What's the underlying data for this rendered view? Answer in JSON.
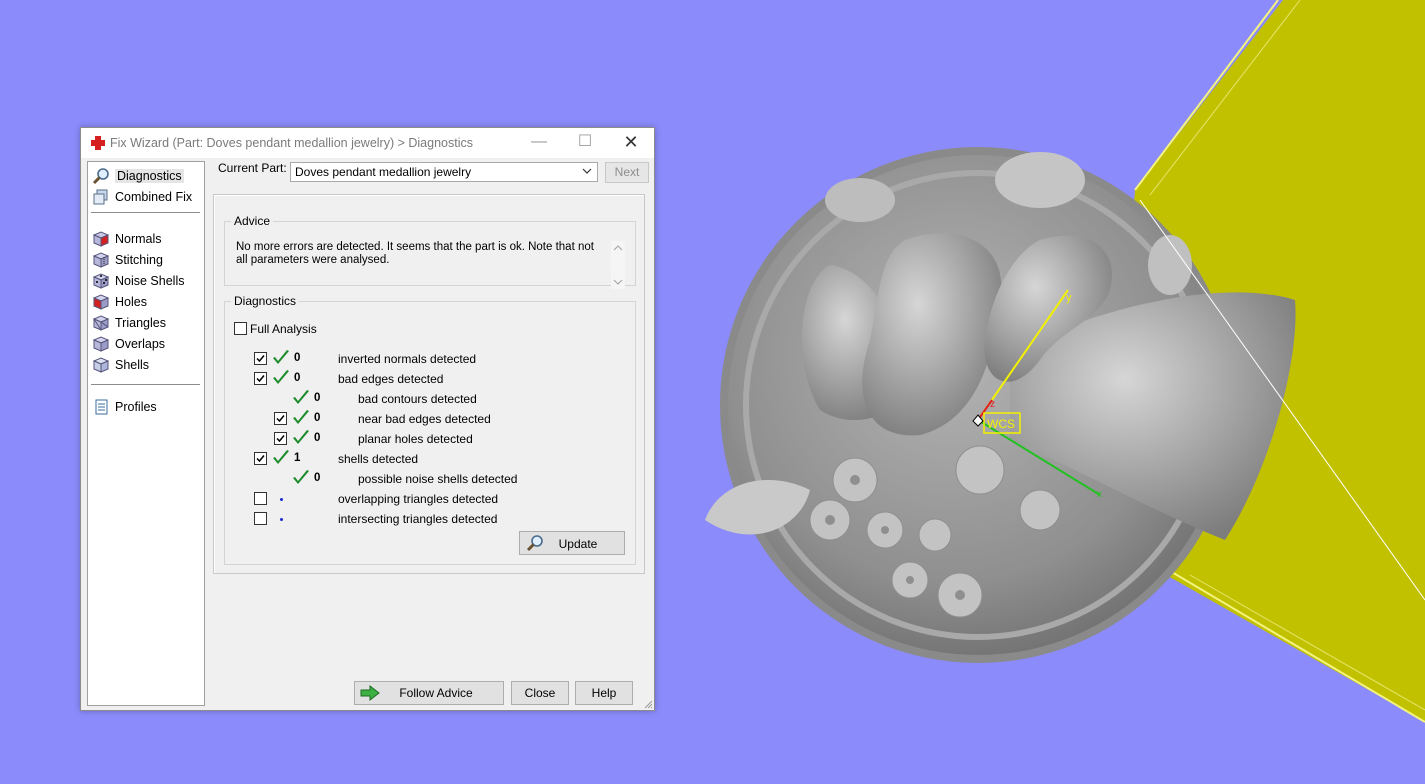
{
  "window": {
    "title": "Fix Wizard (Part: Doves pendant medallion jewelry) > Diagnostics",
    "minimize_glyph": "—",
    "maximize_glyph": "☐",
    "close_glyph": "✕"
  },
  "nav": {
    "items": [
      {
        "label": "Diagnostics",
        "icon": "magnifier-icon",
        "selected": true
      },
      {
        "label": "Combined Fix",
        "icon": "combined-fix-icon"
      },
      {
        "label": "Normals",
        "icon": "normals-cube-icon"
      },
      {
        "label": "Stitching",
        "icon": "stitching-cube-icon"
      },
      {
        "label": "Noise Shells",
        "icon": "noise-shells-icon"
      },
      {
        "label": "Holes",
        "icon": "holes-cube-icon"
      },
      {
        "label": "Triangles",
        "icon": "triangles-cube-icon"
      },
      {
        "label": "Overlaps",
        "icon": "overlaps-icon"
      },
      {
        "label": "Shells",
        "icon": "shells-icon"
      },
      {
        "label": "Profiles",
        "icon": "profiles-document-icon"
      }
    ]
  },
  "current_part": {
    "label": "Current Part:",
    "value": "Doves pendant medallion jewelry",
    "next_label": "Next"
  },
  "advice": {
    "legend": "Advice",
    "text": "No more errors are detected. It seems that the part is ok. Note that not all parameters were analysed."
  },
  "diagnostics": {
    "legend": "Diagnostics",
    "full_analysis_label": "Full Analysis",
    "full_analysis_checked": false,
    "rows": [
      {
        "checked": true,
        "status": "ok",
        "count": "0",
        "label": "inverted normals detected"
      },
      {
        "checked": true,
        "status": "ok",
        "count": "0",
        "label": "bad edges detected"
      },
      {
        "status": "ok",
        "count": "0",
        "label": "bad contours detected"
      },
      {
        "checked": true,
        "status": "ok",
        "count": "0",
        "label": "near bad edges detected"
      },
      {
        "checked": true,
        "status": "ok",
        "count": "0",
        "label": "planar holes detected"
      },
      {
        "checked": true,
        "status": "ok",
        "count": "1",
        "label": "shells detected"
      },
      {
        "status": "ok",
        "count": "0",
        "label": "possible noise shells detected"
      },
      {
        "checked": false,
        "status": "not-analysed",
        "label": "overlapping triangles detected"
      },
      {
        "checked": false,
        "status": "not-analysed",
        "label": "intersecting triangles detected"
      }
    ],
    "update_label": "Update"
  },
  "footer": {
    "follow_advice_label": "Follow Advice",
    "close_label": "Close",
    "help_label": "Help"
  },
  "viewport": {
    "background": "#8b8bfb",
    "plate_color": "#c2c100",
    "model_color": "#9a9a9a",
    "wcs_label": "WCS",
    "axis_y_label": "y",
    "axis_z_label": "z",
    "axis_x_label": "x"
  },
  "colors": {
    "check_green": "#1e8b2c",
    "dot_blue": "#1a2bd0",
    "accent_red": "#d42020"
  }
}
